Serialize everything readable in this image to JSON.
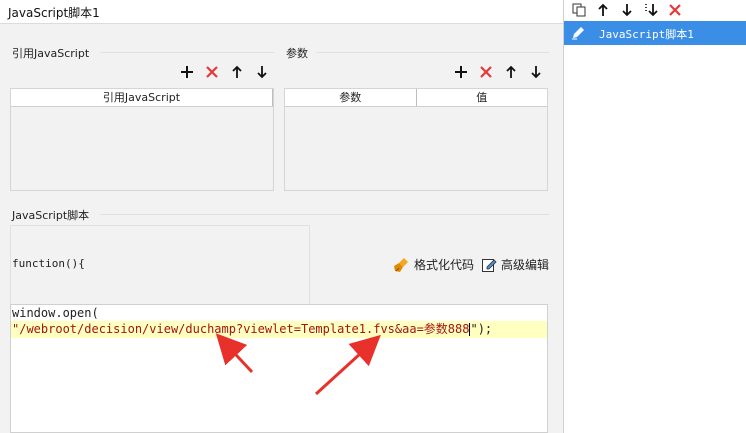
{
  "main": {
    "title": "JavaScript脚本1",
    "ref_section_label": "引用JavaScript",
    "param_section_label": "参数",
    "ref_table": {
      "columns": [
        "引用JavaScript"
      ]
    },
    "param_table": {
      "columns": [
        "参数",
        "值"
      ]
    },
    "script_section_label": "JavaScript脚本",
    "function_signature": "function(){",
    "format_code_label": "格式化代码",
    "advanced_edit_label": "高级编辑",
    "code": {
      "line1": "window.open(",
      "line2_string": "\"/webroot/decision/view/duchamp?viewlet=Template1.fvs&aa=参数888",
      "line2_after_cursor": "\");"
    }
  },
  "right_panel": {
    "items": [
      {
        "label": "JavaScript脚本1"
      }
    ]
  },
  "colors": {
    "accent": "#3b8ee6",
    "delete": "#e53935",
    "highlight": "#ffffc0",
    "annotation_arrow": "#e8312a"
  },
  "icons": [
    "plus-icon",
    "delete-icon",
    "arrow-up-icon",
    "arrow-down-icon",
    "copy-icon",
    "move-bottom-icon",
    "edit-icon",
    "broom-icon",
    "edit-note-icon"
  ]
}
